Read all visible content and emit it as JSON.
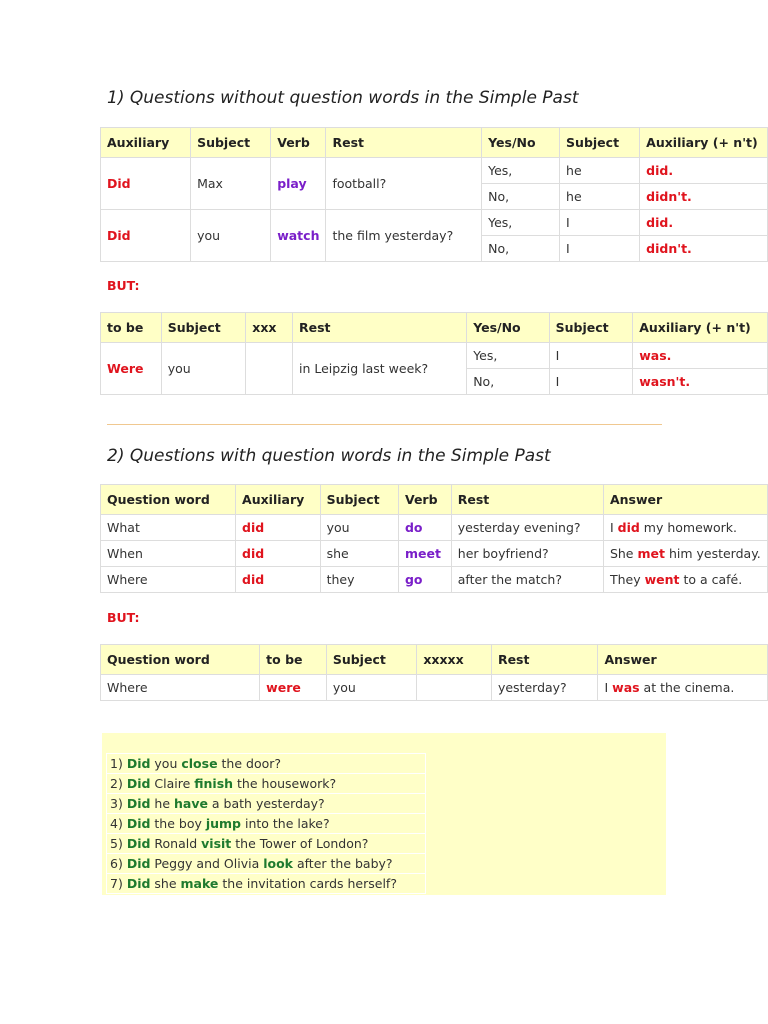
{
  "section1": {
    "title": "1) Questions without question words in the Simple Past",
    "table": {
      "headers": [
        "Auxiliary",
        "Subject",
        "Verb",
        "Rest",
        "Yes/No",
        "Subject",
        "Auxiliary (+ n't)"
      ],
      "groups": [
        {
          "question": [
            {
              "t": "Did",
              "c": "r"
            },
            {
              "t": "Max"
            },
            {
              "t": "play",
              "c": "p"
            },
            {
              "t": "football?"
            }
          ],
          "answers": [
            [
              {
                "t": "Yes,"
              },
              {
                "t": "he"
              },
              {
                "t": "did.",
                "c": "r"
              }
            ],
            [
              {
                "t": "No,"
              },
              {
                "t": "he"
              },
              {
                "t": "didn't.",
                "c": "r"
              }
            ]
          ]
        },
        {
          "question": [
            {
              "t": "Did",
              "c": "r"
            },
            {
              "t": "you"
            },
            {
              "t": "watch",
              "c": "p"
            },
            {
              "t": "the film yesterday?"
            }
          ],
          "answers": [
            [
              {
                "t": "Yes,"
              },
              {
                "t": "I"
              },
              {
                "t": "did.",
                "c": "r"
              }
            ],
            [
              {
                "t": "No,"
              },
              {
                "t": "I"
              },
              {
                "t": "didn't.",
                "c": "r"
              }
            ]
          ]
        }
      ]
    },
    "but_label": "BUT:",
    "table_but": {
      "headers": [
        "to be",
        "Subject",
        "xxx",
        "Rest",
        "Yes/No",
        "Subject",
        "Auxiliary (+ n't)"
      ],
      "groups": [
        {
          "question": [
            {
              "t": "Were",
              "c": "r"
            },
            {
              "t": "you"
            },
            {
              "t": ""
            },
            {
              "t": "in Leipzig last week?"
            }
          ],
          "answers": [
            [
              {
                "t": "Yes,"
              },
              {
                "t": "I"
              },
              {
                "t": "was.",
                "c": "r"
              }
            ],
            [
              {
                "t": "No,"
              },
              {
                "t": "I"
              },
              {
                "t": "wasn't.",
                "c": "r"
              }
            ]
          ]
        }
      ]
    }
  },
  "section2": {
    "title": "2) Questions with question words in the Simple Past",
    "table": {
      "headers": [
        "Question word",
        "Auxiliary",
        "Subject",
        "Verb",
        "Rest",
        "Answer"
      ],
      "rows": [
        [
          [
            {
              "t": "What"
            }
          ],
          [
            {
              "t": "did",
              "c": "r"
            }
          ],
          [
            {
              "t": "you"
            }
          ],
          [
            {
              "t": "do",
              "c": "p"
            }
          ],
          [
            {
              "t": "yesterday evening?"
            }
          ],
          [
            {
              "t": "I "
            },
            {
              "t": "did",
              "c": "r"
            },
            {
              "t": " my homework."
            }
          ]
        ],
        [
          [
            {
              "t": "When"
            }
          ],
          [
            {
              "t": "did",
              "c": "r"
            }
          ],
          [
            {
              "t": "she"
            }
          ],
          [
            {
              "t": "meet",
              "c": "p"
            }
          ],
          [
            {
              "t": "her boyfriend?"
            }
          ],
          [
            {
              "t": "She "
            },
            {
              "t": "met",
              "c": "r"
            },
            {
              "t": " him yesterday."
            }
          ]
        ],
        [
          [
            {
              "t": "Where"
            }
          ],
          [
            {
              "t": "did",
              "c": "r"
            }
          ],
          [
            {
              "t": "they"
            }
          ],
          [
            {
              "t": "go",
              "c": "p"
            }
          ],
          [
            {
              "t": "after the match?"
            }
          ],
          [
            {
              "t": "They "
            },
            {
              "t": "went",
              "c": "r"
            },
            {
              "t": " to a café."
            }
          ]
        ]
      ]
    },
    "but_label": "BUT:",
    "table_but": {
      "headers": [
        "Question word",
        "to be",
        "Subject",
        "xxxxx",
        "Rest",
        "Answer"
      ],
      "rows": [
        [
          [
            {
              "t": "Where"
            }
          ],
          [
            {
              "t": "were",
              "c": "r"
            }
          ],
          [
            {
              "t": "you"
            }
          ],
          [
            {
              "t": ""
            }
          ],
          [
            {
              "t": "yesterday?"
            }
          ],
          [
            {
              "t": "I "
            },
            {
              "t": "was",
              "c": "r"
            },
            {
              "t": " at the cinema."
            }
          ]
        ]
      ]
    }
  },
  "exercise": [
    [
      {
        "t": "1) "
      },
      {
        "t": "Did",
        "c": "g"
      },
      {
        "t": " you "
      },
      {
        "t": "close",
        "c": "g"
      },
      {
        "t": " the door?"
      }
    ],
    [
      {
        "t": "2) "
      },
      {
        "t": "Did",
        "c": "g"
      },
      {
        "t": " Claire "
      },
      {
        "t": "finish",
        "c": "g"
      },
      {
        "t": " the housework?"
      }
    ],
    [
      {
        "t": "3) "
      },
      {
        "t": "Did",
        "c": "g"
      },
      {
        "t": " he "
      },
      {
        "t": "have",
        "c": "g"
      },
      {
        "t": " a bath yesterday?"
      }
    ],
    [
      {
        "t": "4) "
      },
      {
        "t": "Did",
        "c": "g"
      },
      {
        "t": " the boy "
      },
      {
        "t": "jump",
        "c": "g"
      },
      {
        "t": " into the lake?"
      }
    ],
    [
      {
        "t": "5) "
      },
      {
        "t": "Did",
        "c": "g"
      },
      {
        "t": " Ronald "
      },
      {
        "t": "visit",
        "c": "g"
      },
      {
        "t": " the Tower of London?"
      }
    ],
    [
      {
        "t": "6) "
      },
      {
        "t": "Did",
        "c": "g"
      },
      {
        "t": " Peggy and Olivia "
      },
      {
        "t": "look",
        "c": "g"
      },
      {
        "t": " after the baby?"
      }
    ],
    [
      {
        "t": "7) "
      },
      {
        "t": "Did",
        "c": "g"
      },
      {
        "t": " she "
      },
      {
        "t": "make",
        "c": "g"
      },
      {
        "t": " the invitation cards herself?"
      }
    ]
  ]
}
